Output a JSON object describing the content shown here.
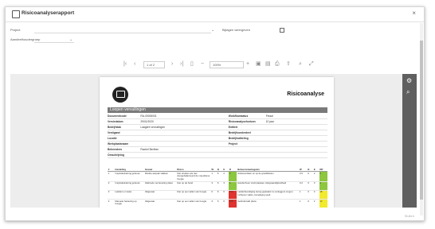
{
  "window": {
    "title": "Risicoanalyserapport",
    "close_glyph": "×"
  },
  "params": {
    "field1_label": "Project",
    "field2_label": "Bijlagen weergeven",
    "field3_label": "Aandeelhoudergroep"
  },
  "toolbar": {
    "page_text": "1 of 2",
    "zoom_text": "100%"
  },
  "report": {
    "title": "Risicoanalyse",
    "section_title": "Loopen vervuilingen",
    "info_rows": [
      {
        "l1": "Documentcode",
        "v1": "RA-00000001",
        "l2": "Workflowstatus",
        "v2": "Finaal"
      },
      {
        "l1": "Versiedatum",
        "v1": "29/01/2020",
        "l2": "Risicoanalysehorizon",
        "v2": "10 jaar"
      },
      {
        "l1": "Bedrijfstak",
        "v1": "Laagere vervuilingen",
        "l2": "Entiteit",
        "v2": ""
      },
      {
        "l1": "Vestigand",
        "v1": "",
        "l2": "Bedrijfsonderdeel",
        "v2": ""
      },
      {
        "l1": "Locatie",
        "v1": "",
        "l2": "Bedrijfsafdeling",
        "v2": ""
      },
      {
        "l1": "Werkplaatsnaam",
        "v1": "",
        "l2": "Project",
        "v2": ""
      },
      {
        "l1": "Beheerders",
        "v1": "Rachel Berthen",
        "l2": "",
        "v2": ""
      },
      {
        "l1": "Omschrijving",
        "v1": "",
        "l2": "",
        "v2": ""
      }
    ],
    "table_headers": [
      "#",
      "Handeling",
      "Gevaar",
      "Risico",
      "W",
      "B",
      "E",
      "R",
      "Beheersmaatregelen",
      "W",
      "B",
      "E",
      "RR"
    ],
    "table_rows": [
      {
        "num": "1",
        "handeling": "Inspiratietraining gebouw",
        "gevaar": "Direkte aanpak vlakken",
        "risico": "Kan struiken als niet doorgebalanceerd de vreedzame hoogte",
        "w": "1",
        "b": "6",
        "e": "2",
        "r": "3",
        "r_color": "#8dc63f",
        "maatregel": "Stofwoordelen en op de grasfiktielen",
        "w2": "0.5",
        "b2": "6",
        "e2": "2",
        "rr": "2",
        "rr_color": "#8dc63f"
      },
      {
        "num": "2",
        "handeling": "Inspiratietraining gebouw",
        "gevaar": "Aliebrede verzameling delen",
        "risico": "Kan op de hand",
        "w": "3",
        "b": "6",
        "e": "3",
        "r": "6",
        "r_color": "#8dc63f",
        "maatregel": "Handschoen vindt plaatsen uitlegvaardigheidheid",
        "w2": "0.2",
        "b2": "6",
        "e2": "3",
        "rr": "3",
        "rr_color": "#8dc63f"
      },
      {
        "num": "3",
        "handeling": "Ladders en leder",
        "gevaar": "Valgevaar",
        "risico": "Kan op een vallen van hoogte",
        "w": "6",
        "b": "6",
        "e": "6",
        "r": "216",
        "r_color": "#e0322e",
        "maatregel": "Ladderbeveiliging stevig geplaatst nu verleggers mogen. Lichtpuur vallen, beveiliging spelt",
        "w2": "1",
        "b2": "6",
        "e2": "3",
        "rr": "18",
        "rr_color": "#f2ea2c"
      },
      {
        "num": "4",
        "handeling": "Manuele hantering op hoogte",
        "gevaar": "Valgevaar",
        "risico": "Kan op een vallen van hoogte",
        "w": "3",
        "b": "6",
        "e": "6",
        "r": "108",
        "r_color": "#e0322e",
        "maatregel": "Gebruikmakt plaza",
        "w2": "1",
        "b2": "6",
        "e2": "2",
        "rr": "12",
        "rr_color": "#f2ea2c"
      }
    ]
  },
  "footer_text": "Sluiten",
  "colors": {
    "sidepanel": "#5f5f5f",
    "section_bar": "#7a7a7a"
  },
  "icons": [
    "report-icon",
    "close-icon",
    "first-page-icon",
    "prev-page-icon",
    "next-page-icon",
    "last-page-icon",
    "zoom-out-icon",
    "zoom-in-icon",
    "export-icon",
    "print-icon",
    "search-icon",
    "fullscreen-icon",
    "settings-icon"
  ]
}
